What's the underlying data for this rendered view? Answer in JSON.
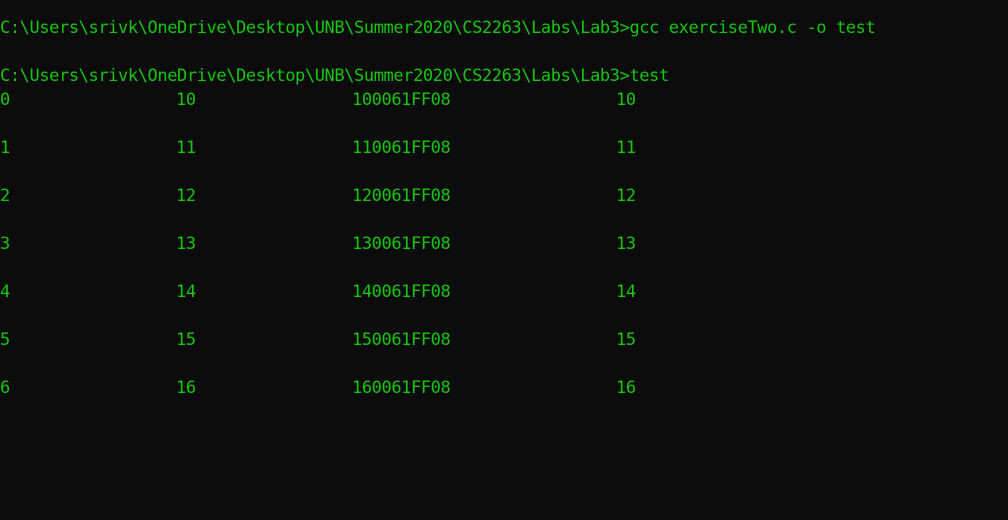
{
  "console": {
    "text_color": "#16c60c",
    "background_color": "#0c0c0c",
    "commands": [
      {
        "prompt": "C:\\Users\\srivk\\OneDrive\\Desktop\\UNB\\Summer2020\\CS2263\\Labs\\Lab3>",
        "command": "gcc exerciseTwo.c -o test"
      },
      {
        "prompt": "C:\\Users\\srivk\\OneDrive\\Desktop\\UNB\\Summer2020\\CS2263\\Labs\\Lab3>",
        "command": "test"
      }
    ],
    "output_rows": [
      [
        "0",
        "10",
        "100061FF08",
        "10"
      ],
      [
        "1",
        "11",
        "110061FF08",
        "11"
      ],
      [
        "2",
        "12",
        "120061FF08",
        "12"
      ],
      [
        "3",
        "13",
        "130061FF08",
        "13"
      ],
      [
        "4",
        "14",
        "140061FF08",
        "14"
      ],
      [
        "5",
        "15",
        "150061FF08",
        "15"
      ],
      [
        "6",
        "16",
        "160061FF08",
        "16"
      ]
    ]
  }
}
